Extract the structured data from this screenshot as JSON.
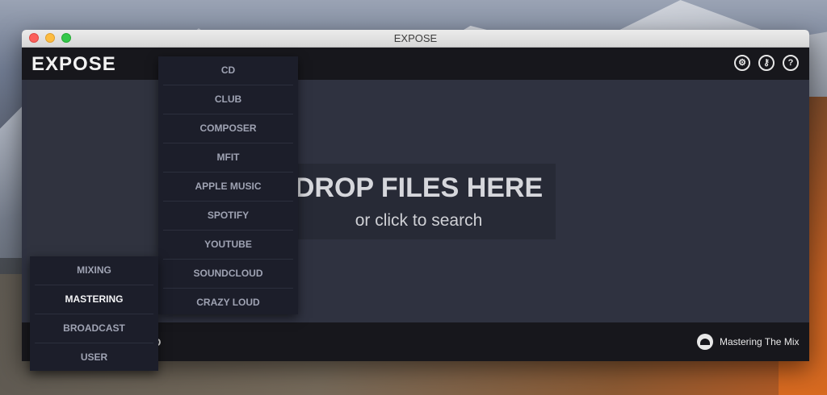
{
  "window": {
    "title": "EXPOSE"
  },
  "app": {
    "logo": "EXPOSE"
  },
  "header_icons": [
    {
      "name": "gear-icon",
      "glyph": "⚙"
    },
    {
      "name": "key-icon",
      "glyph": "⚷"
    },
    {
      "name": "help-icon",
      "glyph": "?"
    }
  ],
  "dropzone": {
    "title": "DROP FILES HERE",
    "subtitle": "or click to search"
  },
  "footer": {
    "left_fragment": "D",
    "brand": "Mastering The Mix"
  },
  "menu_targets": {
    "items": [
      "CD",
      "CLUB",
      "COMPOSER",
      "MFIT",
      "APPLE MUSIC",
      "SPOTIFY",
      "YOUTUBE",
      "SOUNDCLOUD",
      "CRAZY LOUD"
    ]
  },
  "menu_modes": {
    "items": [
      "MIXING",
      "MASTERING",
      "BROADCAST",
      "USER"
    ],
    "selected": "MASTERING"
  }
}
